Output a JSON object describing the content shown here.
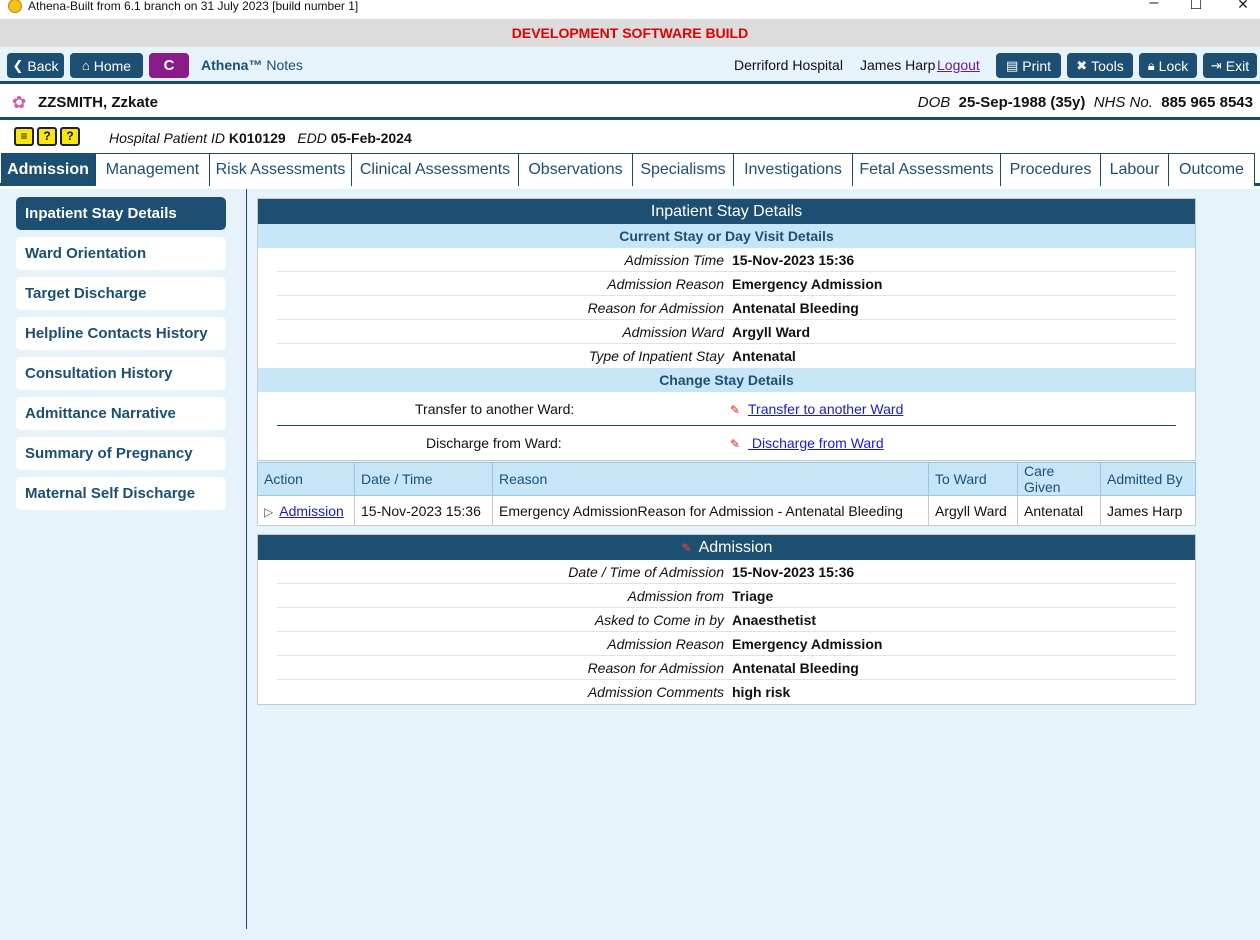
{
  "window": {
    "title": "Athena-Built from 6.1 branch on 31 July 2023 [build number 1]",
    "minimize": "–",
    "maximize": "☐",
    "close": "✕"
  },
  "banner": "DEVELOPMENT SOFTWARE BUILD",
  "topnav": {
    "back": "Back",
    "home": "Home",
    "c_button": "C",
    "app_name": "Athena™",
    "app_section": "Notes",
    "hospital": "Derriford Hospital",
    "user": "James Harp",
    "logout": "Logout",
    "print": "Print",
    "tools": "Tools",
    "lock": "Lock",
    "exit": "Exit"
  },
  "patient": {
    "name": "ZZSMITH, Zzkate",
    "dob_label": "DOB",
    "dob": "25-Sep-1988 (35y)",
    "nhs_label": "NHS No.",
    "nhs": "885 965 8543",
    "hid_label": "Hospital Patient ID",
    "hid": "K010129",
    "edd_label": "EDD",
    "edd": "05-Feb-2024"
  },
  "tabs": [
    "Admission",
    "Management",
    "Risk Assessments",
    "Clinical Assessments",
    "Observations",
    "Specialisms",
    "Investigations",
    "Fetal Assessments",
    "Procedures",
    "Labour",
    "Outcome"
  ],
  "sidebar": [
    "Inpatient Stay Details",
    "Ward Orientation",
    "Target Discharge",
    "Helpline Contacts History",
    "Consultation History",
    "Admittance Narrative",
    "Summary of Pregnancy",
    "Maternal Self Discharge"
  ],
  "stay": {
    "title": "Inpatient Stay Details",
    "current_header": "Current Stay or Day Visit Details",
    "rows": [
      {
        "label": "Admission Time",
        "value": "15-Nov-2023 15:36"
      },
      {
        "label": "Admission Reason",
        "value": "Emergency Admission"
      },
      {
        "label": "Reason for Admission",
        "value": "Antenatal Bleeding"
      },
      {
        "label": "Admission Ward",
        "value": "Argyll Ward"
      },
      {
        "label": "Type of Inpatient Stay",
        "value": "Antenatal"
      }
    ],
    "change_header": "Change Stay Details",
    "transfer_label": "Transfer to another Ward:",
    "transfer_link": "Transfer to another Ward",
    "discharge_label": "Discharge from Ward:",
    "discharge_link": " Discharge from Ward"
  },
  "grid": {
    "headers": [
      "Action",
      "Date / Time",
      "Reason",
      "To Ward",
      "Care Given",
      "Admitted By"
    ],
    "rows": [
      {
        "action": "Admission",
        "datetime": "15-Nov-2023 15:36",
        "reason": "Emergency AdmissionReason for Admission - Antenatal Bleeding",
        "ward": "Argyll Ward",
        "care": "Antenatal",
        "by": "James Harp"
      }
    ]
  },
  "admission": {
    "title": "Admission",
    "rows": [
      {
        "label": "Date / Time of Admission",
        "value": "15-Nov-2023 15:36"
      },
      {
        "label": "Admission from",
        "value": "Triage"
      },
      {
        "label": "Asked to Come in by",
        "value": "Anaesthetist"
      },
      {
        "label": "Admission Reason",
        "value": "Emergency Admission"
      },
      {
        "label": "Reason for Admission",
        "value": "Antenatal Bleeding"
      },
      {
        "label": "Admission Comments",
        "value": "high risk"
      }
    ]
  },
  "colors": {
    "primary": "#1c4f72",
    "accent": "#8a1b8a",
    "banner_text": "#e00000",
    "link": "#1a1ad0"
  }
}
